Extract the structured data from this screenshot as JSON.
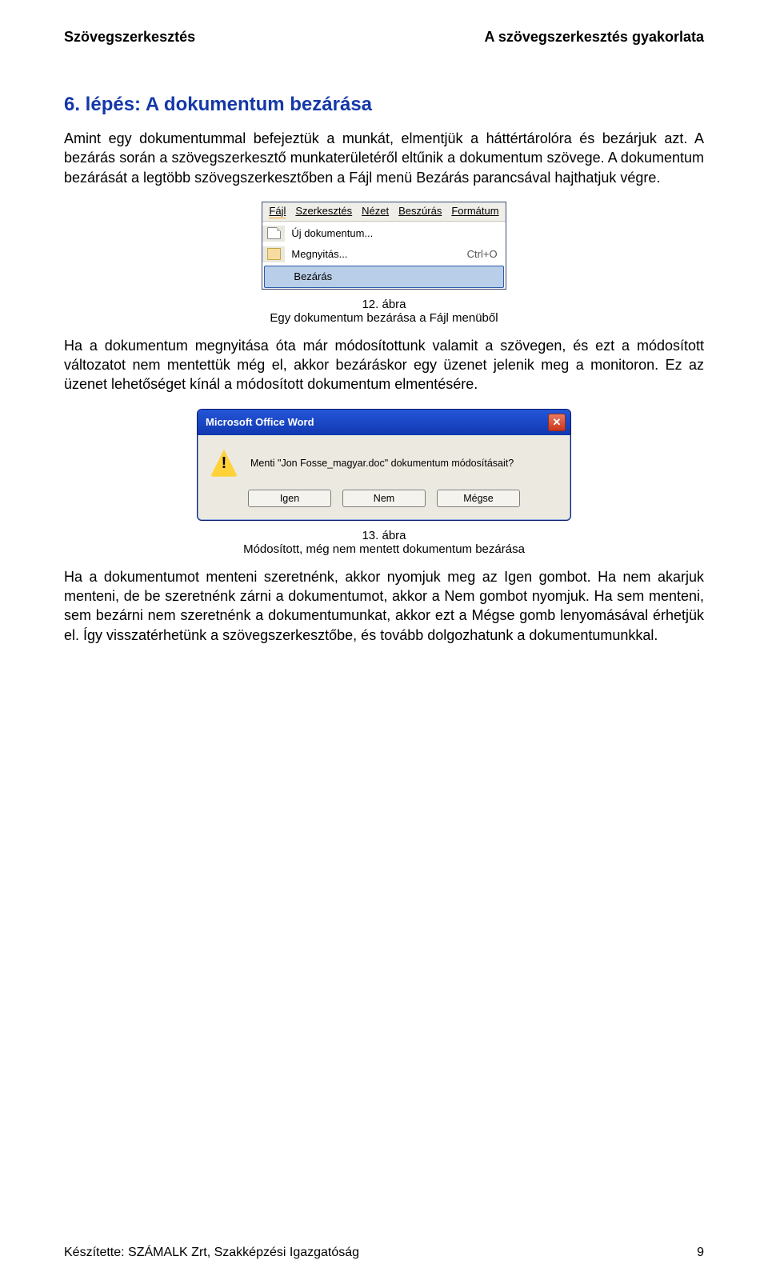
{
  "header": {
    "left": "Szövegszerkesztés",
    "right": "A szövegszerkesztés gyakorlata"
  },
  "section_title": "6. lépés: A dokumentum bezárása",
  "para1": "Amint egy dokumentummal befejeztük a munkát, elmentjük a háttértárolóra és bezárjuk azt. A bezárás során a szövegszerkesztő munkaterületéről eltűnik a dokumentum szövege. A dokumentum bezárását a legtöbb szövegszerkesztőben a Fájl menü Bezárás parancsával hajthatjuk végre.",
  "figure1": {
    "menubar": [
      "Fájl",
      "Szerkesztés",
      "Nézet",
      "Beszúrás",
      "Formátum"
    ],
    "items": [
      {
        "label": "Új dokumentum..."
      },
      {
        "label": "Megnyitás...",
        "shortcut": "Ctrl+O"
      },
      {
        "label": "Bezárás",
        "selected": true
      }
    ],
    "caption_num": "12. ábra",
    "caption_text": "Egy dokumentum bezárása a Fájl menüből"
  },
  "para2": "Ha a dokumentum megnyitása óta már módosítottunk valamit a szövegen, és ezt a módosított változatot nem mentettük még el, akkor bezáráskor egy üzenet jelenik meg a monitoron. Ez az üzenet lehetőséget kínál a módosított dokumentum elmentésére.",
  "dialog": {
    "title": "Microsoft Office Word",
    "message": "Menti \"Jon Fosse_magyar.doc\" dokumentum módosításait?",
    "buttons": {
      "yes": "Igen",
      "no": "Nem",
      "cancel": "Mégse"
    },
    "caption_num": "13. ábra",
    "caption_text": "Módosított, még nem mentett dokumentum bezárása"
  },
  "para3": "Ha a dokumentumot menteni szeretnénk, akkor nyomjuk meg az Igen gombot. Ha nem akarjuk menteni, de be szeretnénk zárni a dokumentumot, akkor a Nem gombot nyomjuk. Ha sem menteni, sem bezárni nem szeretnénk a dokumentumunkat, akkor ezt a Mégse gomb lenyomásával érhetjük el. Így visszatérhetünk a szövegszerkesztőbe, és tovább dolgozhatunk a dokumentumunkkal.",
  "footer": {
    "left": "Készítette: SZÁMALK Zrt, Szakképzési Igazgatóság",
    "page": "9"
  }
}
